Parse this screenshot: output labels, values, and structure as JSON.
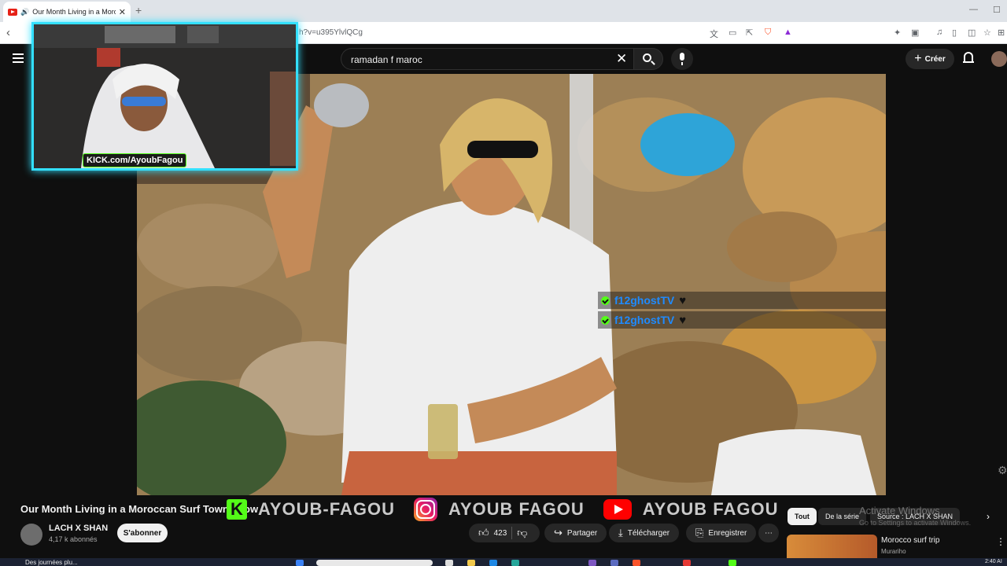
{
  "browser": {
    "tab_title": "Our Month Living in a Moroc",
    "url_fragment": "h?v=u395YlvlQCg",
    "new_tab": "+",
    "tab_close": "✕"
  },
  "header": {
    "search_value": "ramadan f maroc",
    "create_label": "Créer"
  },
  "overlay": {
    "webcam_badge": "KICK.com/AyoubFagou",
    "chat": [
      {
        "user": "f12ghostTV"
      },
      {
        "user": "f12ghostTV"
      }
    ],
    "socials": [
      {
        "platform": "kick",
        "text": "AYOUB-FAGOU"
      },
      {
        "platform": "instagram",
        "text": "AYOUB FAGOU"
      },
      {
        "platform": "youtube",
        "text": "AYOUB FAGOU"
      }
    ]
  },
  "video": {
    "title": "Our Month Living in a Moroccan Surf Town",
    "title_suffix": "ow",
    "channel_name": "LACH X SHAN",
    "subscribers": "4,17 k abonnés",
    "subscribe_label": "S'abonner",
    "likes": "423",
    "share_label": "Partager",
    "download_label": "Télécharger",
    "save_label": "Enregistrer"
  },
  "sidebar": {
    "chips": [
      "Tout",
      "De la série",
      "Source : LACH X SHAN"
    ],
    "recommendations": [
      {
        "title": "Morocco surf trip",
        "channel": "Murariho"
      }
    ]
  },
  "windows": {
    "watermark_title": "Activate Windows",
    "watermark_sub": "Go to Settings to activate Windows.",
    "taskbar_text": "Des journées plu...",
    "time": "2:40 AI"
  },
  "colors": {
    "kick_green": "#53fc18",
    "webcam_border": "#33e0ff",
    "chat_user": "#1f8bff",
    "youtube_red": "#ff0000"
  }
}
